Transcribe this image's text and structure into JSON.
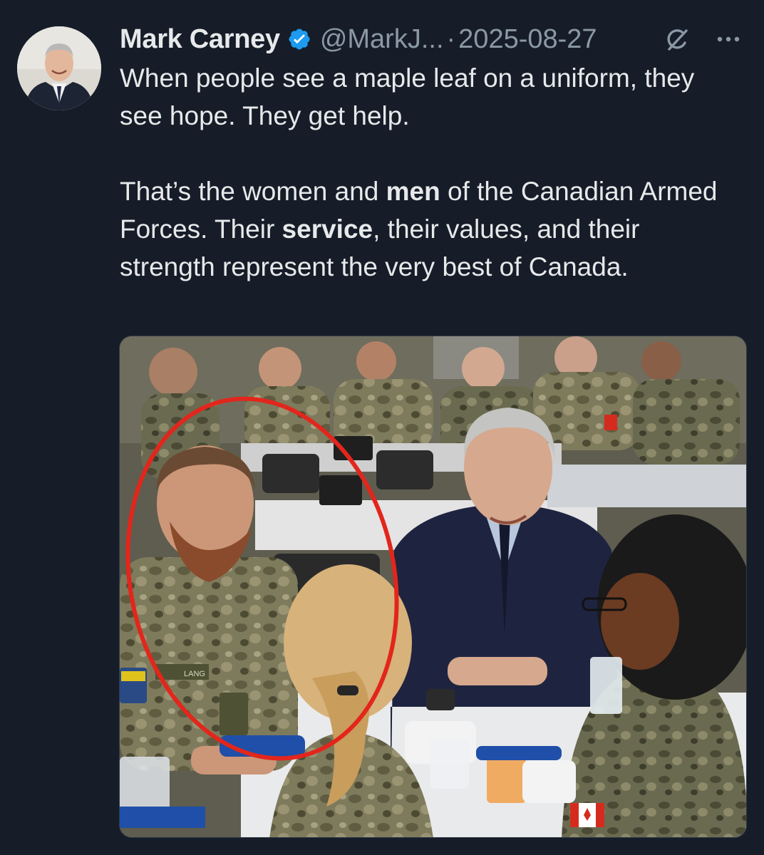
{
  "author": {
    "name": "Mark Carney",
    "handle": "@MarkJ...",
    "verified": true,
    "avatar_icon": "person-avatar"
  },
  "meta": {
    "separator": "·",
    "date": "2025-08-27"
  },
  "actions": {
    "grok_icon": "grok-icon",
    "more_icon": "more-dots-icon"
  },
  "tweet": {
    "p1": "When people see a maple leaf on a uniform, they see hope. They get help.",
    "p2_part1": "That’s the women and ",
    "p2_bold1": "men",
    "p2_part2": " of the Canadian Armed Forces. Their ",
    "p2_bold2": "service",
    "p2_part3": ", their values, and their strength represent the very best of Canada."
  },
  "media": {
    "type": "photo",
    "name_tape": "LANG",
    "annotation_color": "#e2261c"
  },
  "colors": {
    "background": "#161d29",
    "text": "#e7e9ea",
    "secondary_text": "#8b98a5",
    "verified_blue": "#1d9bf0"
  }
}
